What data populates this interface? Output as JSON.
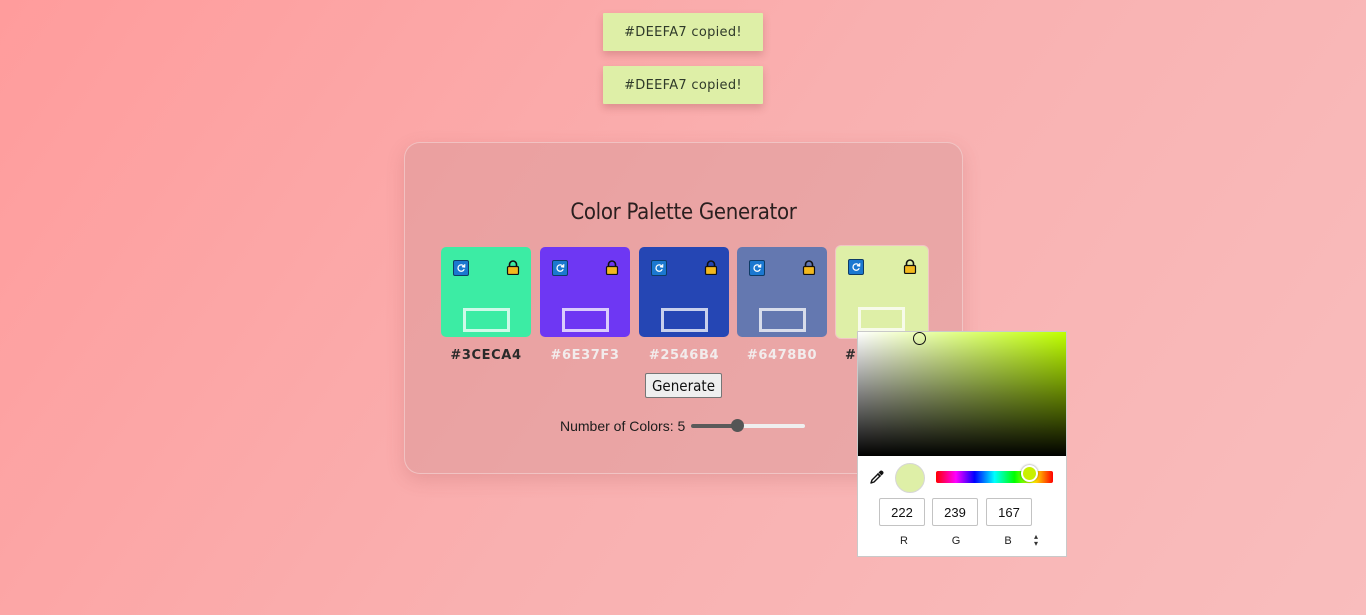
{
  "toasts": [
    "#DEEFA7 copied!",
    "#DEEFA7 copied!"
  ],
  "title": "Color Palette Generator",
  "palette": [
    {
      "hex": "#3CECA4",
      "label": "#3CECA4",
      "label_color": "#2a2a2a"
    },
    {
      "hex": "#6E37F3",
      "label": "#6E37F3",
      "label_color": "#f2ecec"
    },
    {
      "hex": "#2546B4",
      "label": "#2546B4",
      "label_color": "#f2ecec"
    },
    {
      "hex": "#6478B0",
      "label": "#6478B0",
      "label_color": "#f2ecec"
    },
    {
      "hex": "#DEEFA7",
      "label": "#DEEFA7",
      "label_color": "#2a2a2a",
      "visible_label": "#I"
    }
  ],
  "generate_label": "Generate",
  "count": {
    "label": "Number of Colors: 5",
    "value": 5,
    "min": 3,
    "max": 8
  },
  "picker": {
    "color": "#DEEFA7",
    "hue_fraction": 0.795,
    "saturation": 0.3,
    "brightness": 0.94,
    "r": "222",
    "g": "239",
    "b": "167",
    "r_label": "R",
    "g_label": "G",
    "b_label": "B"
  },
  "icons": {
    "refresh": "refresh-icon",
    "lock": "lock-icon",
    "eyedropper": "eyedropper-icon",
    "mode_toggle": "chevron-up-down-icon"
  }
}
